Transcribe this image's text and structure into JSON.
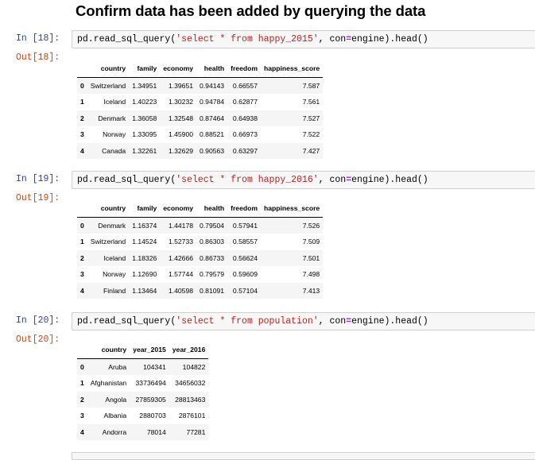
{
  "heading": "Confirm data has been added by querying the data",
  "cells": [
    {
      "in_prompt": "In [18]:",
      "out_prompt": "Out[18]:",
      "code": {
        "pre": "pd.read_sql_query(",
        "str": "'select * from happy_2015'",
        "mid": ", con",
        "op": "=",
        "post": "engine).head()"
      },
      "table": {
        "columns": [
          "",
          "country",
          "family",
          "economy",
          "health",
          "freedom",
          "happiness_score"
        ],
        "rows": [
          [
            "0",
            "Switzerland",
            "1.34951",
            "1.39651",
            "0.94143",
            "0.66557",
            "7.587"
          ],
          [
            "1",
            "Iceland",
            "1.40223",
            "1.30232",
            "0.94784",
            "0.62877",
            "7.561"
          ],
          [
            "2",
            "Denmark",
            "1.36058",
            "1.32548",
            "0.87464",
            "0.64938",
            "7.527"
          ],
          [
            "3",
            "Norway",
            "1.33095",
            "1.45900",
            "0.88521",
            "0.66973",
            "7.522"
          ],
          [
            "4",
            "Canada",
            "1.32261",
            "1.32629",
            "0.90563",
            "0.63297",
            "7.427"
          ]
        ]
      }
    },
    {
      "in_prompt": "In [19]:",
      "out_prompt": "Out[19]:",
      "code": {
        "pre": "pd.read_sql_query(",
        "str": "'select * from happy_2016'",
        "mid": ", con",
        "op": "=",
        "post": "engine).head()"
      },
      "table": {
        "columns": [
          "",
          "country",
          "family",
          "economy",
          "health",
          "freedom",
          "happiness_score"
        ],
        "rows": [
          [
            "0",
            "Denmark",
            "1.16374",
            "1.44178",
            "0.79504",
            "0.57941",
            "7.526"
          ],
          [
            "1",
            "Switzerland",
            "1.14524",
            "1.52733",
            "0.86303",
            "0.58557",
            "7.509"
          ],
          [
            "2",
            "Iceland",
            "1.18326",
            "1.42666",
            "0.86733",
            "0.56624",
            "7.501"
          ],
          [
            "3",
            "Norway",
            "1.12690",
            "1.57744",
            "0.79579",
            "0.59609",
            "7.498"
          ],
          [
            "4",
            "Finland",
            "1.13464",
            "1.40598",
            "0.81091",
            "0.57104",
            "7.413"
          ]
        ]
      }
    },
    {
      "in_prompt": "In [20]:",
      "out_prompt": "Out[20]:",
      "code": {
        "pre": "pd.read_sql_query(",
        "str": "'select * from population'",
        "mid": ", con",
        "op": "=",
        "post": "engine).head()"
      },
      "table": {
        "columns": [
          "",
          "country",
          "year_2015",
          "year_2016"
        ],
        "rows": [
          [
            "0",
            "Aruba",
            "104341",
            "104822"
          ],
          [
            "1",
            "Afghanistan",
            "33736494",
            "34656032"
          ],
          [
            "2",
            "Angola",
            "27859305",
            "28813463"
          ],
          [
            "3",
            "Albania",
            "2880703",
            "2876101"
          ],
          [
            "4",
            "Andorra",
            "78014",
            "77281"
          ]
        ]
      }
    }
  ]
}
